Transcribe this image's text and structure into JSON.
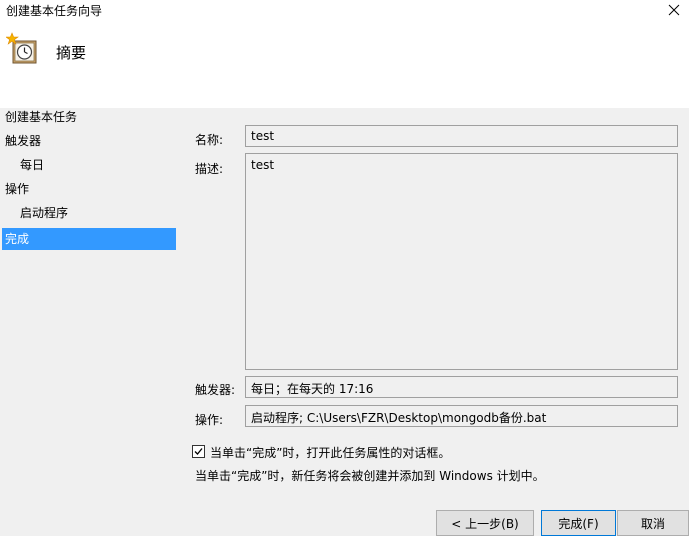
{
  "window": {
    "title": "创建基本任务向导"
  },
  "header": {
    "title": "摘要"
  },
  "nav": {
    "items": [
      {
        "label": "创建基本任务",
        "selected": false
      },
      {
        "label": "触发器",
        "selected": false
      },
      {
        "label": "每日",
        "selected": false
      },
      {
        "label": "操作",
        "selected": false
      },
      {
        "label": "启动程序",
        "selected": false
      },
      {
        "label": "完成",
        "selected": true
      }
    ]
  },
  "summary": {
    "name_label": "名称:",
    "name_value": "test",
    "description_label": "描述:",
    "description_value": "test",
    "trigger_label": "触发器:",
    "trigger_value": "每日；在每天的 17:16",
    "action_label": "操作:",
    "action_value": "启动程序; C:\\Users\\FZR\\Desktop\\mongodb备份.bat"
  },
  "options": {
    "open_properties_label": "当单击“完成”时，打开此任务属性的对话框。",
    "open_properties_checked": true,
    "info_text": "当单击“完成”时，新任务将会被创建并添加到 Windows 计划中。"
  },
  "buttons": {
    "back": "< 上一步(B)",
    "finish": "完成(F)",
    "cancel": "取消"
  },
  "colors": {
    "selection": "#3399ff",
    "panel_bg": "#f0f0f0",
    "border": "#a0a0a0",
    "primary_border": "#0078d7"
  }
}
